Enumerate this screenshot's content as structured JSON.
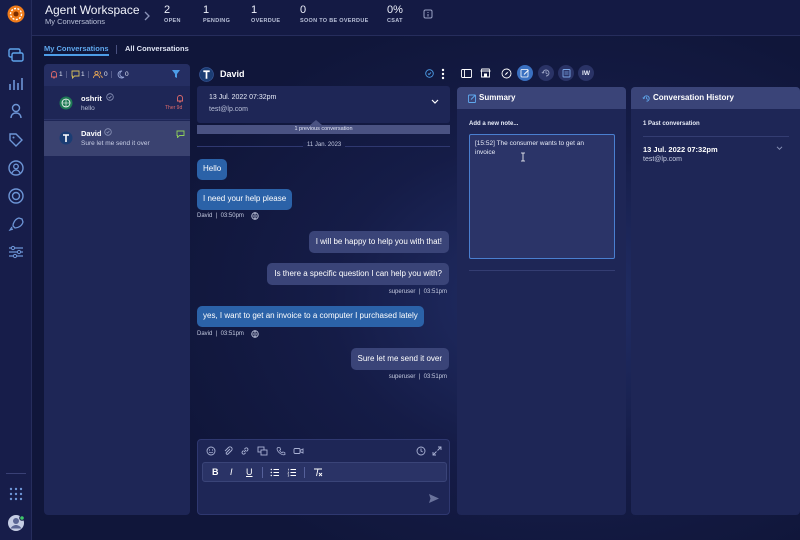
{
  "header": {
    "title": "Agent Workspace",
    "subtitle": "My Conversations",
    "stats": [
      {
        "value": "2",
        "label": "OPEN"
      },
      {
        "value": "1",
        "label": "PENDING"
      },
      {
        "value": "1",
        "label": "OVERDUE"
      },
      {
        "value": "0",
        "label": "SOON TO BE OVERDUE"
      },
      {
        "value": "0%",
        "label": "CSAT"
      }
    ]
  },
  "tabs": {
    "my": "My Conversations",
    "all": "All Conversations"
  },
  "filters": {
    "alerts": "1",
    "messages": "1",
    "people": "0",
    "sleep": "0"
  },
  "conversations": [
    {
      "name": "oshrit",
      "preview": "hello",
      "badge": "Ther 9d"
    },
    {
      "name": "David",
      "preview": "Sure let me send it over"
    }
  ],
  "chat": {
    "name": "David",
    "date_header": "13 Jul. 2022 07:32pm",
    "email": "test@lp.com",
    "previous": "1 previous conversation",
    "divider_date": "11 Jan. 2023",
    "messages": [
      {
        "text": "Hello",
        "dir": "in"
      },
      {
        "text": "I need your help please",
        "dir": "in",
        "sender": "David",
        "time": "03:50pm"
      },
      {
        "text": "I will be happy to help you with that!",
        "dir": "out"
      },
      {
        "text": "Is there a specific question I can help you with?",
        "dir": "out",
        "sender": "superuser",
        "time": "03:51pm"
      },
      {
        "text": "yes, I want to get an invoice to a computer I purchased lately",
        "dir": "in",
        "sender": "David",
        "time": "03:51pm"
      },
      {
        "text": "Sure let me send it over",
        "dir": "out",
        "sender": "superuser",
        "time": "03:51pm"
      }
    ]
  },
  "composer": {
    "bold": "B",
    "italic": "I",
    "underline": "U"
  },
  "summary": {
    "title": "Summary",
    "add_note_label": "Add a new note...",
    "note": "[15:52] The consumer wants to get an invoice"
  },
  "history": {
    "title": "Conversation History",
    "count": "1 Past conversation",
    "item_date": "13 Jul. 2022 07:32pm",
    "item_email": "test@lp.com"
  },
  "toolbar": {
    "iw": "IW"
  },
  "colors": {
    "accent": "#3a8ee6",
    "incoming_bubble": "#2b62a8",
    "outgoing_bubble": "#3a4478",
    "panel": "#1e2656"
  }
}
